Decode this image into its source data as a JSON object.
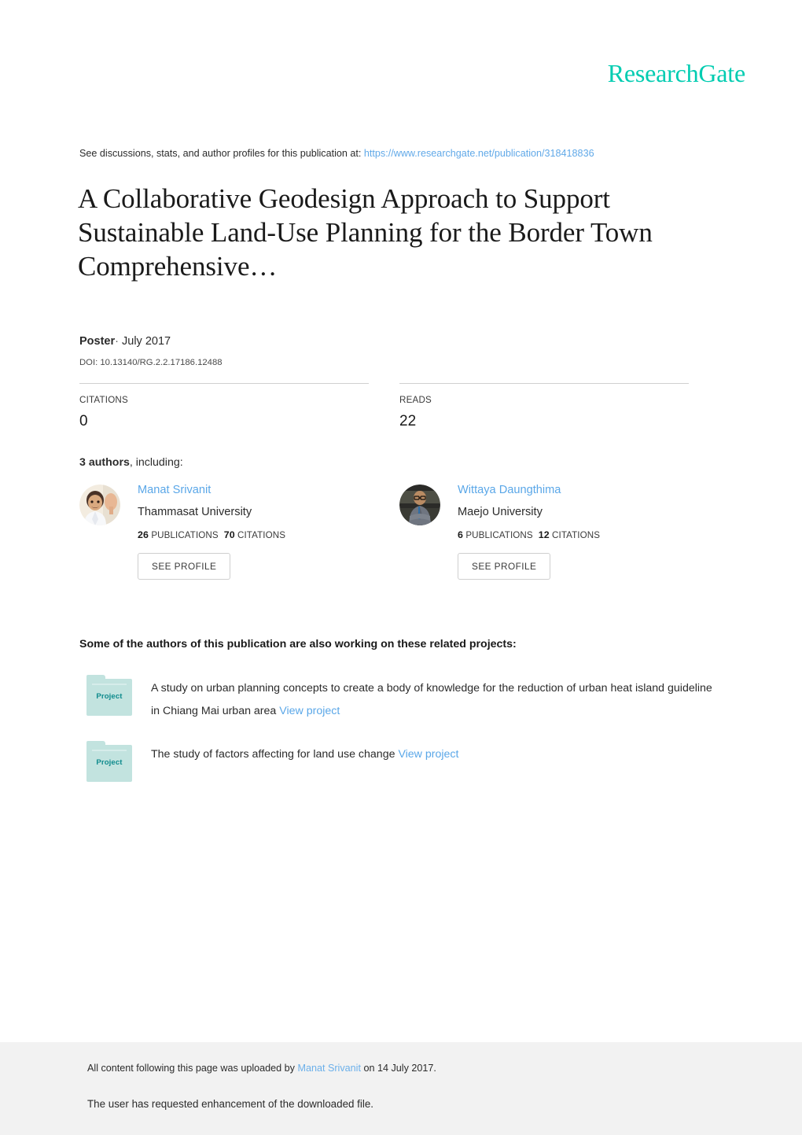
{
  "brand": {
    "logo_text": "ResearchGate",
    "logo_color": "#00ccb1",
    "link_color": "#5aa7e8"
  },
  "header": {
    "discussion_prefix": "See discussions, stats, and author profiles for this publication at:",
    "publication_url": "https://www.researchgate.net/publication/318418836"
  },
  "publication": {
    "title": "A Collaborative Geodesign Approach to Support Sustainable Land-Use Planning for the Border Town Comprehensive…",
    "type": "Poster",
    "separator": "·",
    "date": "July 2017",
    "doi": "DOI: 10.13140/RG.2.2.17186.12488"
  },
  "stats": {
    "citations_label": "CITATIONS",
    "citations_value": "0",
    "reads_label": "READS",
    "reads_value": "22"
  },
  "authors_section": {
    "count_text": "3 authors",
    "including_text": ", including:",
    "authors": [
      {
        "name": "Manat Srivanit",
        "affiliation": "Thammasat University",
        "publications_count": "26",
        "publications_label": "PUBLICATIONS",
        "citations_count": "70",
        "citations_label": "CITATIONS",
        "profile_button": "SEE PROFILE",
        "avatar_name": "avatar-manat-srivanit"
      },
      {
        "name": "Wittaya Daungthima",
        "affiliation": "Maejo University",
        "publications_count": "6",
        "publications_label": "PUBLICATIONS",
        "citations_count": "12",
        "citations_label": "CITATIONS",
        "profile_button": "SEE PROFILE",
        "avatar_name": "avatar-wittaya-daungthima"
      }
    ]
  },
  "projects_section": {
    "heading": "Some of the authors of this publication are also working on these related projects:",
    "folder_label": "Project",
    "view_link_label": "View project",
    "projects": [
      {
        "description": "A study on urban planning concepts to create a body of knowledge for the reduction of urban heat island guideline in Chiang Mai urban area",
        "link_label": "View project"
      },
      {
        "description": "The study of factors affecting for land use change",
        "link_label": "View project"
      }
    ]
  },
  "footer": {
    "upload_prefix": "All content following this page was uploaded by",
    "uploader_name": "Manat Srivanit",
    "upload_suffix": "on 14 July 2017.",
    "enhancement_note": "The user has requested enhancement of the downloaded file."
  }
}
